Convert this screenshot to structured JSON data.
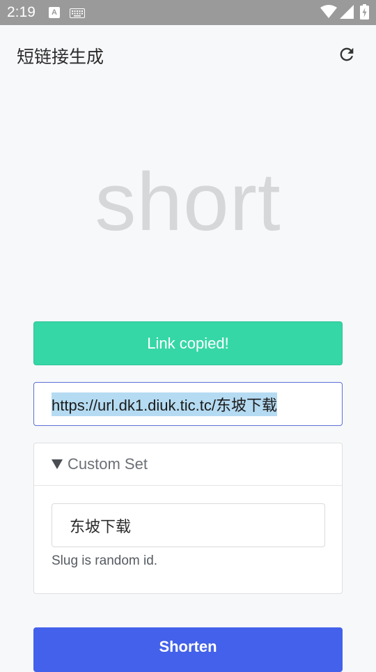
{
  "status_bar": {
    "time": "2:19",
    "input_badge": "A",
    "icons": [
      "keyboard-icon",
      "wifi-icon",
      "signal-icon",
      "battery-charging-icon"
    ]
  },
  "app_bar": {
    "title": "短链接生成",
    "refresh_icon": "refresh-icon"
  },
  "hero": {
    "text": "short"
  },
  "toast": {
    "label": "Link copied!",
    "color": "#36d7a6"
  },
  "url_field": {
    "value": "https://url.dk1.diuk.tic.tc/东坡下载",
    "selected": true
  },
  "custom_set": {
    "header": "Custom Set",
    "expanded": true,
    "slug_input_value": "东坡下载",
    "help_text": "Slug is random id."
  },
  "actions": {
    "shorten_label": "Shorten",
    "accent_color": "#4361ea"
  }
}
